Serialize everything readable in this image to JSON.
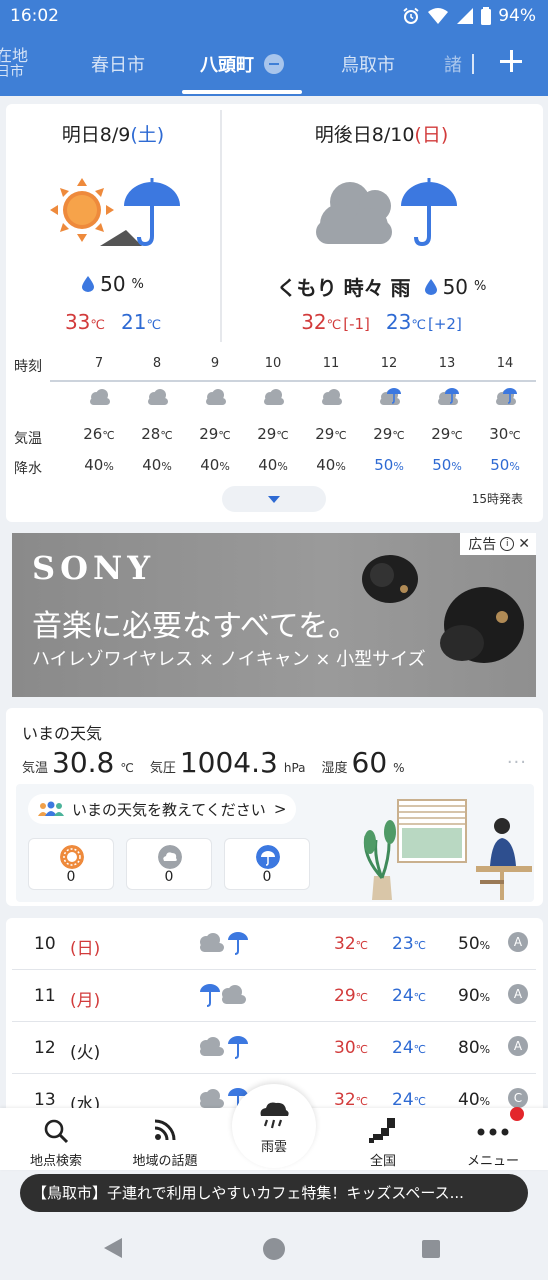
{
  "status_bar": {
    "time": "16:02",
    "battery": "94%"
  },
  "tabs": {
    "current_location_line1": "在地",
    "current_location_line2": "日市",
    "items": [
      "春日市",
      "八頭町",
      "鳥取市",
      "諸"
    ]
  },
  "forecast": {
    "tomorrow": {
      "label": "明日8/9",
      "weekday": "(土)",
      "rain_chance": "50",
      "rain_unit": "%",
      "high": "33",
      "low": "21",
      "unit": "℃"
    },
    "day_after": {
      "label": "明後日8/10",
      "weekday": "(日)",
      "description": "くもり 時々 雨",
      "rain_chance": "50",
      "rain_unit": "%",
      "high": "32",
      "high_diff": "[-1]",
      "low": "23",
      "low_diff": "[+2]",
      "unit": "℃"
    }
  },
  "hourly": {
    "labels": {
      "time": "時刻",
      "temp": "気温",
      "rain": "降水"
    },
    "hours": [
      {
        "hour": "7",
        "temp": "26",
        "rain": "40",
        "icon": "cloud-icon"
      },
      {
        "hour": "8",
        "temp": "28",
        "rain": "40",
        "icon": "cloud-icon"
      },
      {
        "hour": "9",
        "temp": "29",
        "rain": "40",
        "icon": "cloud-icon"
      },
      {
        "hour": "10",
        "temp": "29",
        "rain": "40",
        "icon": "cloud-icon"
      },
      {
        "hour": "11",
        "temp": "29",
        "rain": "40",
        "icon": "cloud-icon"
      },
      {
        "hour": "12",
        "temp": "29",
        "rain": "50",
        "icon": "cloud-umbrella-icon"
      },
      {
        "hour": "13",
        "temp": "29",
        "rain": "50",
        "icon": "cloud-umbrella-icon"
      },
      {
        "hour": "14",
        "temp": "30",
        "rain": "50",
        "icon": "cloud-umbrella-icon"
      }
    ],
    "temp_unit": "℃",
    "rain_unit": "%",
    "issued": "15時発表"
  },
  "ad": {
    "brand": "SONY",
    "copy1": "音楽に必要なすべてを。",
    "copy2": "ハイレゾワイヤレス × ノイキャン × 小型サイズ",
    "label": "広告",
    "info": "i",
    "close": "✕"
  },
  "now": {
    "title": "いまの天気",
    "temp_label": "気温",
    "temp": "30.8",
    "temp_unit": "℃",
    "pressure_label": "気圧",
    "pressure": "1004.3",
    "pressure_unit": "hPa",
    "humidity_label": "湿度",
    "humidity": "60",
    "humidity_unit": "%",
    "more": "···",
    "report_prompt": "いまの天気を教えてください",
    "report_chevron": ">",
    "reports": [
      {
        "icon": "sun-icon",
        "count": "0"
      },
      {
        "icon": "cloud-icon",
        "count": "0"
      },
      {
        "icon": "rain-icon",
        "count": "0"
      }
    ]
  },
  "daily": {
    "temp_unit": "℃",
    "rain_unit": "%",
    "rows": [
      {
        "date": "10",
        "weekday": "(日)",
        "high": "32",
        "low": "23",
        "rain": "50",
        "rank": "A"
      },
      {
        "date": "11",
        "weekday": "(月)",
        "high": "29",
        "low": "24",
        "rain": "90",
        "rank": "A"
      },
      {
        "date": "12",
        "weekday": "(火)",
        "high": "30",
        "low": "24",
        "rain": "80",
        "rank": "A"
      },
      {
        "date": "13",
        "weekday": "(水)",
        "high": "32",
        "low": "24",
        "rain": "40",
        "rank": "C"
      }
    ]
  },
  "bottom_nav": {
    "search": "地点検索",
    "topics": "地域の話題",
    "rain_radar": "雨雲",
    "country": "全国",
    "menu": "メニュー"
  },
  "ticker": "【鳥取市】子連れで利用しやすいカフェ特集！キッズスペース...",
  "colors": {
    "header": "#3f7fd6",
    "high": "#d23b3b",
    "low": "#2e6ad3"
  }
}
